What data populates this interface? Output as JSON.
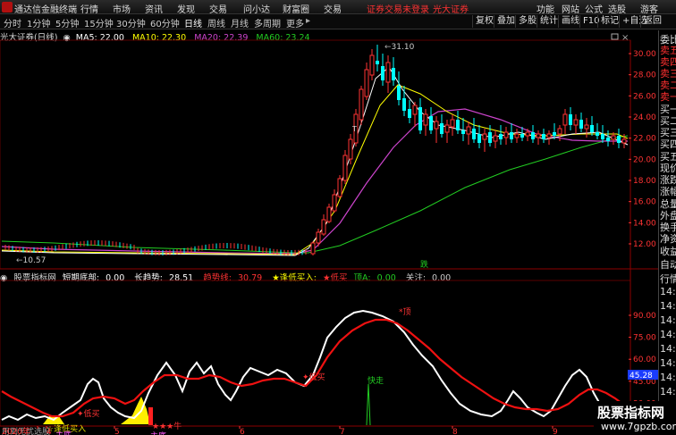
{
  "titlebar": {
    "app_name": "通达信金融终端",
    "menus": [
      "行情",
      "市场",
      "资讯",
      "发现",
      "交易",
      "问小达",
      "财富圈",
      "交易"
    ],
    "promo1": "证券交易未登录",
    "promo2": "光大证券",
    "right": [
      "功能",
      "网站",
      "公式",
      "选股",
      "游客"
    ]
  },
  "toolbar": {
    "periods": [
      "分时",
      "1分钟",
      "5分钟",
      "15分钟",
      "30分钟",
      "60分钟",
      "日线",
      "周线",
      "月线",
      "多周期",
      "更多"
    ],
    "active": "日线",
    "right_buttons": [
      "复权",
      "叠加",
      "多股",
      "统计",
      "画线",
      "F10",
      "标记",
      "+自选",
      "返回"
    ]
  },
  "main": {
    "stock_name": "光大证券(日线)",
    "ma": [
      {
        "label": "MA5:",
        "value": "22.00",
        "color": "#ffffff"
      },
      {
        "label": "MA10:",
        "value": "22.30",
        "color": "#ffff00"
      },
      {
        "label": "MA20:",
        "value": "22.39",
        "color": "#cc44cc"
      },
      {
        "label": "MA60:",
        "value": "23.24",
        "color": "#22cc22"
      }
    ],
    "peak_label": "31.10",
    "low_label": "10.57",
    "t_marker": "T",
    "signal_die": "跌",
    "price_ticks": [
      "30.00",
      "28.00",
      "26.00",
      "24.00",
      "22.00",
      "20.00",
      "18.00",
      "16.00",
      "14.00",
      "12.00"
    ]
  },
  "sub": {
    "title": "股票指标网",
    "items": [
      {
        "label": "短期底部:",
        "value": "0.00",
        "color": "#ffffff"
      },
      {
        "label": "长趋势:",
        "value": "28.51",
        "color": "#ffffff"
      },
      {
        "label": "趋势线:",
        "value": "30.79",
        "color": "#ff3333"
      },
      {
        "label": "★逢低买入:",
        "value": "",
        "color": "#ffff00"
      },
      {
        "label": "★低买",
        "value": "",
        "color": "#ff3333"
      },
      {
        "label": "顶A:",
        "value": "0.00",
        "color": "#22cc22"
      },
      {
        "label": "关注:",
        "value": "0.00",
        "color": "#cccccc"
      }
    ],
    "ticks": [
      "90.00",
      "75.00",
      "60.00",
      "45.00",
      "30.00",
      "15.00"
    ],
    "current_value": "45.28",
    "annotations": {
      "di": "*顶",
      "dimai1": "低买",
      "dimai2": "低买",
      "kuaizou": "快走",
      "fengdi": "逢低买入",
      "niu": "★★★牛",
      "yongdao": "用到无忧选股",
      "zhudi1": "主底",
      "zhudi2": "主底"
    }
  },
  "xaxis": {
    "labels": [
      "2020年",
      "4",
      "5",
      "6",
      "7",
      "8",
      "9"
    ]
  },
  "rightpanel": {
    "items": [
      "委比",
      "卖五",
      "卖四",
      "卖三",
      "卖二",
      "卖一",
      "买一",
      "买二",
      "买三",
      "买四",
      "买五",
      "现价",
      "涨跌",
      "涨幅",
      "总量",
      "外盘",
      "换手",
      "净资",
      "收益",
      "自动",
      "行情",
      "14:5",
      "14:5",
      "14:5",
      "14:5",
      "14:5",
      "14:5",
      "14:5",
      "14:5",
      "14:5"
    ]
  },
  "watermark": {
    "line1": "股票指标网",
    "line2": "www.7gpzb.com"
  },
  "colors": {
    "up": "#ff3333",
    "down": "#00ffff",
    "ma5": "#ffffff",
    "ma10": "#ffff00",
    "ma20": "#cc44cc",
    "ma60": "#22cc22"
  }
}
